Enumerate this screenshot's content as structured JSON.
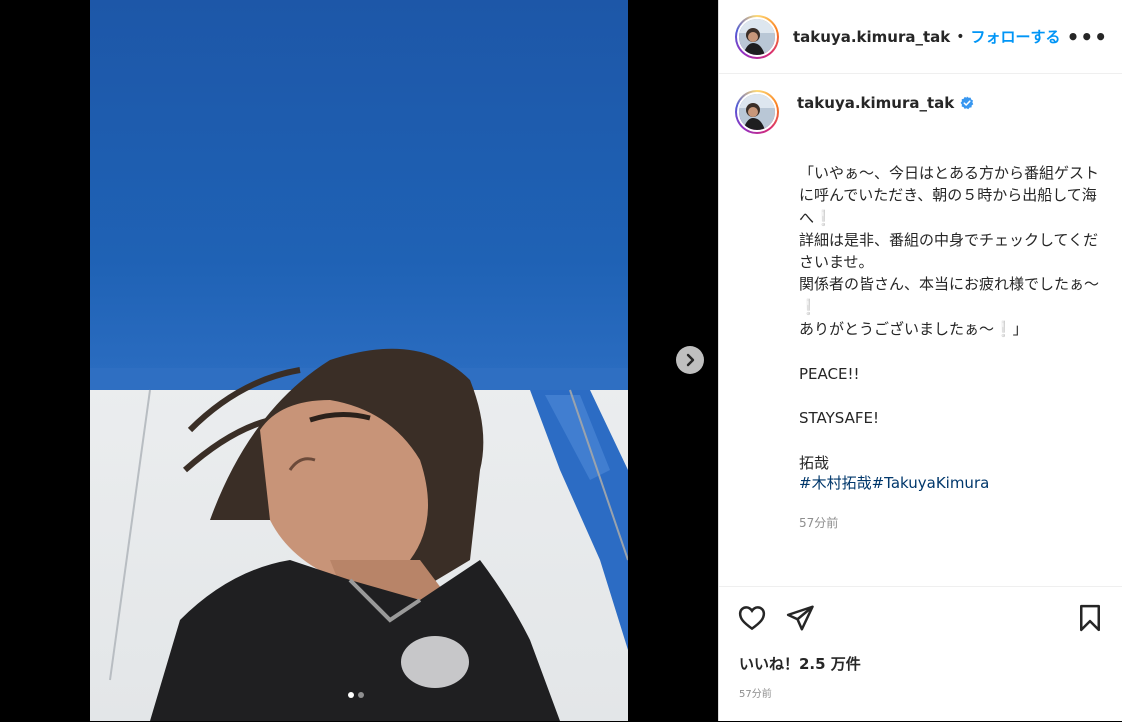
{
  "post": {
    "username": "takuya.kimura_tak",
    "header_separator": "•",
    "follow_label": "フォローする",
    "more_label": "•••",
    "caption": "「いやぁ～、今日はとある方から番組ゲストに呼んでいただき、朝の５時から出船して海へ❕\n詳細は是非、番組の中身でチェックしてくださいませ。\n関係者の皆さん、本当にお疲れ様でしたぁ～❕\nありがとうございましたぁ～❕」\n\nPEACE!!\n\nSTAYSAFE!\n\n拓哉",
    "hashtags": [
      "#木村拓哉",
      "#TakuyaKimura"
    ],
    "caption_time": "57分前",
    "likes": "いいね！2.5 万件",
    "post_time": "57分前"
  },
  "icons": {
    "avatar": "avatar-photo",
    "verified": "verified-badge-icon",
    "like": "heart-icon",
    "share": "paper-plane-icon",
    "save": "bookmark-icon",
    "next": "chevron-right-icon"
  },
  "carousel": {
    "total_slides": 2,
    "current_slide": 1
  },
  "colors": {
    "follow_blue": "#0095f6",
    "hashtag": "#00376b",
    "verified": "#3897f0",
    "awning_blue": "#1f5fb0"
  }
}
